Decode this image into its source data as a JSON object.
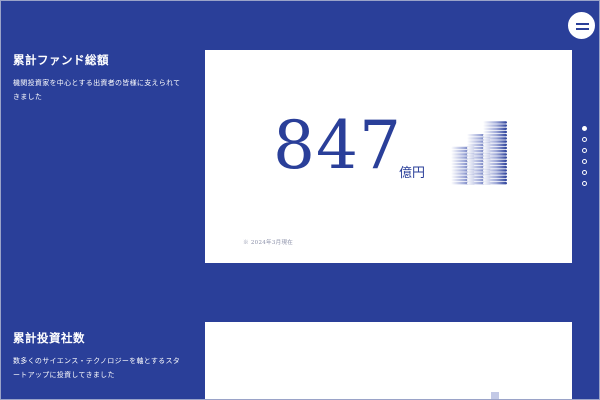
{
  "sections": [
    {
      "title": "累計ファンド総額",
      "description": "機関投資家を中心とする出資者の皆様に支えられてきました",
      "value": "847",
      "unit": "億円",
      "note": "※ 2024年3月現在"
    },
    {
      "title": "累計投資社数",
      "description": "数多くのサイエンス・テクノロジーを軸とするスタートアップに投資してきました"
    }
  ],
  "page_dots": {
    "count": 6,
    "active_index": 0
  },
  "colors": {
    "background": "#2a3f99",
    "accent": "#2a3f99",
    "card": "#ffffff"
  },
  "icons": {
    "menu": "hamburger-menu-icon",
    "coins": "coin-stacks-icon"
  }
}
